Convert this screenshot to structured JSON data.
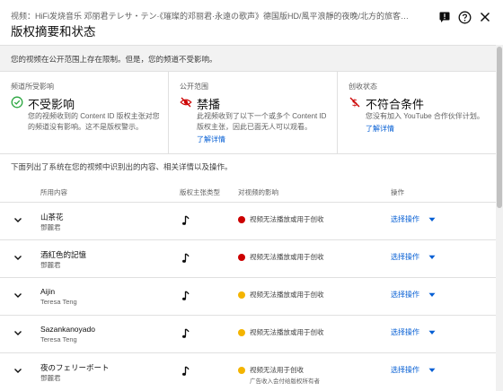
{
  "header": {
    "video_line": "视频：HiFi发烧音乐 邓丽君テレサ・テン·《璀璨的邓丽君·永遠の歌声》德国版HD/風平浪靜的夜晚/北方的旅客/Yes、被愛包圍著/...",
    "title": "版权摘要和状态",
    "icons": [
      "feedback-icon",
      "help-icon",
      "close-icon"
    ]
  },
  "banner": {
    "text": "您的视频在公开范围上存在限制。但是，您的频道不受影响。"
  },
  "cards": [
    {
      "label": "频道所受影响",
      "value": "不受影响",
      "icon": "check-circle-icon",
      "icon_color": "#2ba640",
      "desc": "您的视频收到的 Content ID 版权主张对您的频道没有影响。这不是版权警示。",
      "link": ""
    },
    {
      "label": "公开范围",
      "value": "禁播",
      "icon": "visibility-off-icon",
      "icon_color": "#cc0000",
      "desc": "此视频收到了以下一个或多个 Content ID 版权主张，因此已面无人可以观看。",
      "link": "了解详情"
    },
    {
      "label": "创收状态",
      "value": "不符合条件",
      "icon": "money-off-icon",
      "icon_color": "#cc0000",
      "desc": "您没有加入 YouTube 合作伙伴计划。",
      "link": "了解详情"
    }
  ],
  "intro": "下面列出了系统在您的视频中识别出的内容、相关详情以及操作。",
  "table": {
    "columns": [
      "所用内容",
      "版权主张类型",
      "对视频的影响",
      "操作"
    ],
    "rows": [
      {
        "title": "山茶花",
        "artist": "鄧麗君",
        "dot_color": "#cc0000",
        "impact": "视频无法播放或用于创收",
        "impact_note": "",
        "action": "选择操作"
      },
      {
        "title": "酒紅色的記憶",
        "artist": "鄧麗君",
        "dot_color": "#cc0000",
        "impact": "视频无法播放或用于创收",
        "impact_note": "",
        "action": "选择操作"
      },
      {
        "title": "Aijin",
        "artist": "Teresa Teng",
        "dot_color": "#f4b400",
        "impact": "视频无法播放或用于创收",
        "impact_note": "",
        "action": "选择操作"
      },
      {
        "title": "Sazankanoyado",
        "artist": "Teresa Teng",
        "dot_color": "#f4b400",
        "impact": "视频无法播放或用于创收",
        "impact_note": "",
        "action": "选择操作"
      },
      {
        "title": "夜のフェリーボート",
        "artist": "鄧麗君",
        "dot_color": "#f4b400",
        "impact": "视频无法用于创收",
        "impact_note": "广告收入会付给版权所有者",
        "action": "选择操作"
      }
    ]
  },
  "colors": {
    "accent": "#065fd4",
    "red": "#cc0000",
    "yellow": "#f4b400",
    "green": "#2ba640"
  }
}
